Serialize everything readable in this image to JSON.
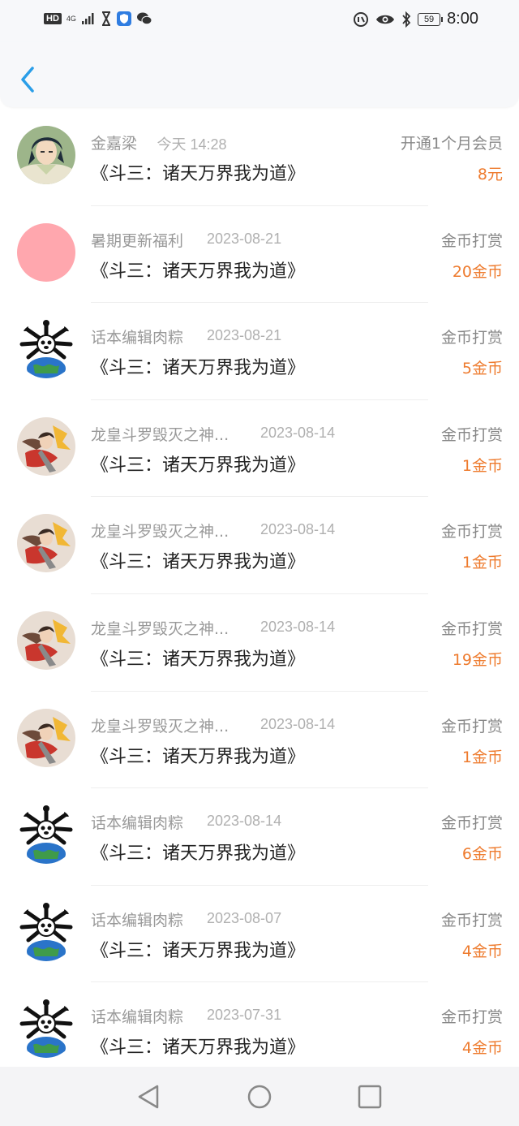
{
  "status_bar": {
    "hd": "HD",
    "network": "4G",
    "battery": "59",
    "time": "8:00"
  },
  "nav": {
    "back_icon": "chevron-left-icon",
    "accent": "#2a9ee8"
  },
  "colors": {
    "amount": "#ee7b2e",
    "secondary_text": "#999999"
  },
  "records": [
    {
      "name": "金嘉梁",
      "date": "今天 14:28",
      "book": "《斗三：诸天万界我为道》",
      "type": "开通1个月会员",
      "amount": "8元",
      "avatar": "anime-boy"
    },
    {
      "name": "暑期更新福利",
      "date": "2023-08-21",
      "book": "《斗三：诸天万界我为道》",
      "type": "金币打赏",
      "amount": "20金币",
      "avatar": "pink-circle"
    },
    {
      "name": "话本编辑肉粽",
      "date": "2023-08-21",
      "book": "《斗三：诸天万界我为道》",
      "type": "金币打赏",
      "amount": "5金币",
      "avatar": "panda-earth"
    },
    {
      "name": "龙皇斗罗毁灭之神...",
      "date": "2023-08-14",
      "book": "《斗三：诸天万界我为道》",
      "type": "金币打赏",
      "amount": "1金币",
      "avatar": "anime-warrior"
    },
    {
      "name": "龙皇斗罗毁灭之神...",
      "date": "2023-08-14",
      "book": "《斗三：诸天万界我为道》",
      "type": "金币打赏",
      "amount": "1金币",
      "avatar": "anime-warrior"
    },
    {
      "name": "龙皇斗罗毁灭之神...",
      "date": "2023-08-14",
      "book": "《斗三：诸天万界我为道》",
      "type": "金币打赏",
      "amount": "19金币",
      "avatar": "anime-warrior"
    },
    {
      "name": "龙皇斗罗毁灭之神...",
      "date": "2023-08-14",
      "book": "《斗三：诸天万界我为道》",
      "type": "金币打赏",
      "amount": "1金币",
      "avatar": "anime-warrior"
    },
    {
      "name": "话本编辑肉粽",
      "date": "2023-08-14",
      "book": "《斗三：诸天万界我为道》",
      "type": "金币打赏",
      "amount": "6金币",
      "avatar": "panda-earth"
    },
    {
      "name": "话本编辑肉粽",
      "date": "2023-08-07",
      "book": "《斗三：诸天万界我为道》",
      "type": "金币打赏",
      "amount": "4金币",
      "avatar": "panda-earth"
    },
    {
      "name": "话本编辑肉粽",
      "date": "2023-07-31",
      "book": "《斗三：诸天万界我为道》",
      "type": "金币打赏",
      "amount": "4金币",
      "avatar": "panda-earth"
    }
  ],
  "bottom_nav": {
    "back": "triangle-back-icon",
    "home": "circle-home-icon",
    "recents": "square-recents-icon"
  }
}
